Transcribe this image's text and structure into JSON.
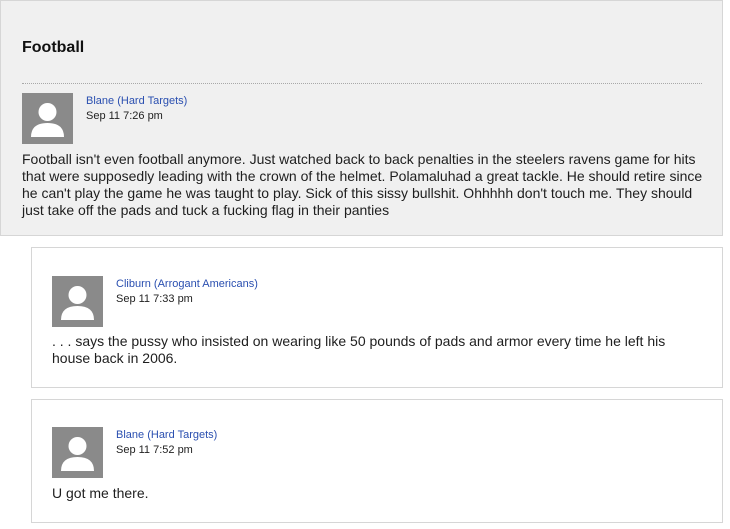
{
  "topic": {
    "title": "Football",
    "post": {
      "author": "Blane",
      "team": "Hard Targets",
      "time": "Sep 11 7:26 pm",
      "body": "Football isn't even football anymore. Just watched back to back penalties in the steelers ravens game for hits that were supposedly leading with the crown of the helmet. Polamaluhad a great tackle. He should retire since he can't play the game he was taught to play. Sick of this sissy bullshit. Ohhhhh don't touch me. They should just take off the pads and tuck a fucking flag in their panties"
    }
  },
  "replies": [
    {
      "author": "Cliburn",
      "team": "Arrogant Americans",
      "time": "Sep 11 7:33 pm",
      "body": ". . . says the pussy who insisted on wearing like 50 pounds of pads and armor every time he left his house back in 2006."
    },
    {
      "author": "Blane",
      "team": "Hard Targets",
      "time": "Sep 11 7:52 pm",
      "body": "U got me there."
    }
  ],
  "icons": {
    "avatar": "default-user-avatar-icon"
  },
  "colors": {
    "link": "#2a4fb0",
    "panel_bg": "#f0f0f0",
    "border": "#d6d6d6",
    "avatar_bg": "#8a8a8a"
  }
}
